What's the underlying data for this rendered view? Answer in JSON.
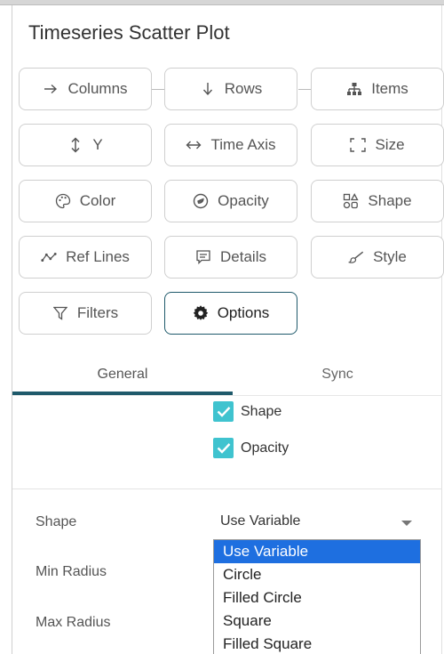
{
  "panel": {
    "title": "Timeseries Scatter Plot"
  },
  "buttons": {
    "columns": "Columns",
    "rows": "Rows",
    "items": "Items",
    "y": "Y",
    "time_axis": "Time Axis",
    "size": "Size",
    "color": "Color",
    "opacity": "Opacity",
    "shape": "Shape",
    "ref_lines": "Ref Lines",
    "details": "Details",
    "style": "Style",
    "filters": "Filters",
    "options": "Options"
  },
  "tabs": {
    "general": "General",
    "sync": "Sync",
    "active": "General"
  },
  "checkboxes": [
    {
      "label": "Shape",
      "checked": true
    },
    {
      "label": "Opacity",
      "checked": true
    }
  ],
  "form": {
    "shape_label": "Shape",
    "shape_value": "Use Variable",
    "min_radius_label": "Min Radius",
    "max_radius_label": "Max Radius"
  },
  "dropdown": {
    "options": [
      "Use Variable",
      "Circle",
      "Filled Circle",
      "Square",
      "Filled Square"
    ],
    "selected": "Use Variable"
  },
  "colors": {
    "accent": "#1f5a6b",
    "checkbox": "#3fc3cf",
    "selection": "#1e6fe0"
  }
}
